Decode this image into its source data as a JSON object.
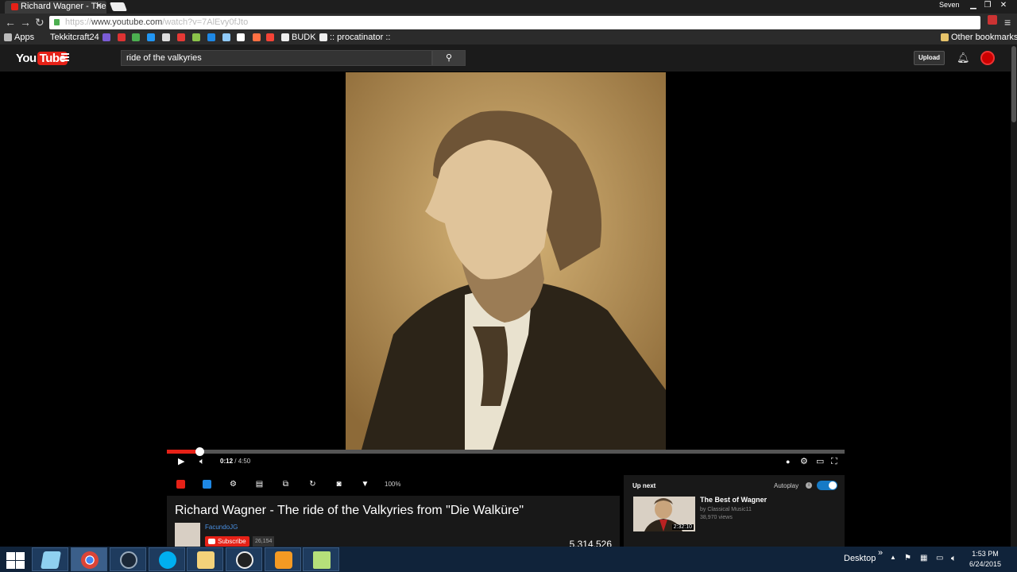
{
  "browser": {
    "tab_title": "Richard Wagner - The ride of the Valkyries",
    "tab_close": "✕",
    "profile_name": "Seven",
    "url_scheme": "https://",
    "url_host": "www.youtube.com",
    "url_path": "/watch?v=7AlEvy0fJto",
    "bookmarks": {
      "apps": "Apps",
      "tekkit": "Tekkitcraft24",
      "budk": "BUDK",
      "procatinator": ":: procatinator ::",
      "other": "Other bookmarks"
    }
  },
  "youtube": {
    "logo_you": "You",
    "logo_tube": "Tube",
    "search_query": "ride of the valkyries",
    "search_icon": "⚲",
    "upload_label": "Upload"
  },
  "player": {
    "current_time": "0:12",
    "duration": "4:50",
    "progress_fraction": 0.048,
    "zoom_level": "100%"
  },
  "video_info": {
    "title": "Richard Wagner - The ride of the Valkyries from \"Die Walküre\"",
    "channel": "FacundoJG",
    "subscribe_label": "Subscribe",
    "subscriber_count": "26,154",
    "views": "5,314,526"
  },
  "up_next": {
    "label": "Up next",
    "autoplay_label": "Autoplay",
    "autoplay_on": true,
    "video_title": "The Best of Wagner",
    "video_channel": "by Classical Music11",
    "video_views": "38,970 views",
    "video_duration": "2:32:10"
  },
  "taskbar": {
    "desktop_label": "Desktop",
    "overflow": "»",
    "time": "1:53 PM",
    "date": "6/24/2015"
  },
  "colors": {
    "youtube_red": "#e62117",
    "autoplay_blue": "#167ac6",
    "channel_link": "#4a90e2"
  }
}
